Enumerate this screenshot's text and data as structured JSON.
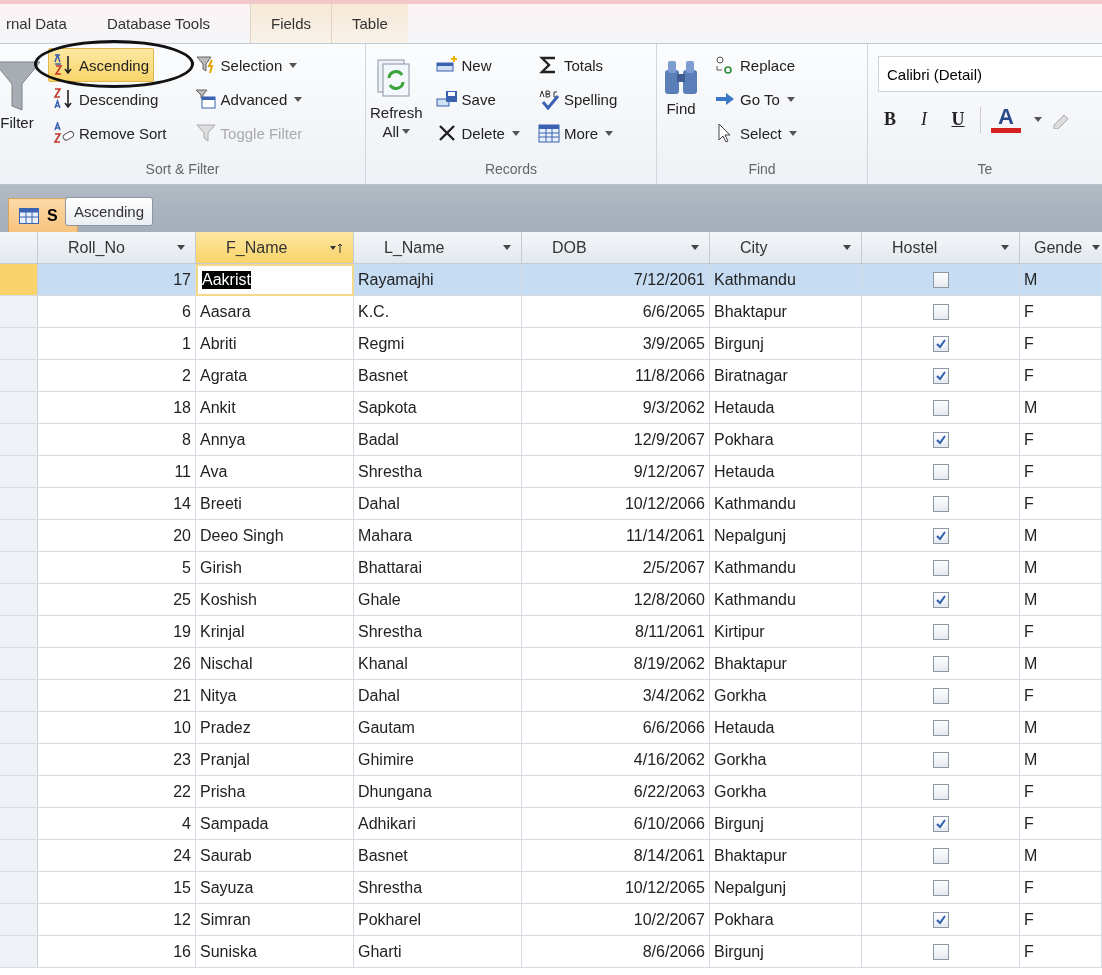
{
  "ribbon_tabs": [
    {
      "label": "rnal Data",
      "contextual": false
    },
    {
      "label": "Database Tools",
      "contextual": false
    },
    {
      "label": "Fields",
      "contextual": true
    },
    {
      "label": "Table",
      "contextual": true
    }
  ],
  "sort_filter": {
    "label": "Sort & Filter",
    "large_button": "Filter",
    "items": [
      {
        "label": "Ascending",
        "dropdown": false,
        "disabled": false,
        "highlighted": true,
        "circled": true
      },
      {
        "label": "Descending",
        "dropdown": false,
        "disabled": false,
        "highlighted": false,
        "circled": false
      },
      {
        "label": "Remove Sort",
        "dropdown": false,
        "disabled": false,
        "highlighted": false,
        "circled": false
      },
      {
        "label": "Selection",
        "dropdown": true,
        "disabled": false,
        "highlighted": false,
        "circled": false
      },
      {
        "label": "Advanced",
        "dropdown": true,
        "disabled": false,
        "highlighted": false,
        "circled": false
      },
      {
        "label": "Toggle Filter",
        "dropdown": false,
        "disabled": true,
        "highlighted": false,
        "circled": false
      }
    ]
  },
  "records": {
    "label": "Records",
    "large_button": "Refresh",
    "large_button_line2": "All",
    "items": [
      {
        "label": "New",
        "dropdown": false
      },
      {
        "label": "Save",
        "dropdown": false
      },
      {
        "label": "Delete",
        "dropdown": true
      },
      {
        "label": "Totals",
        "dropdown": false
      },
      {
        "label": "Spelling",
        "dropdown": false
      },
      {
        "label": "More",
        "dropdown": true
      }
    ]
  },
  "find": {
    "label": "Find",
    "large_button": "Find",
    "items": [
      {
        "label": "Replace",
        "dropdown": false
      },
      {
        "label": "Go To",
        "dropdown": true
      },
      {
        "label": "Select",
        "dropdown": true
      }
    ]
  },
  "text_formatting": {
    "label": "Te",
    "font_field": "Calibri (Detail)",
    "buttons": [
      "B",
      "I",
      "U"
    ],
    "font_color_button": "A"
  },
  "document_tab": {
    "label": "S"
  },
  "tooltip": {
    "text": "Ascending"
  },
  "table": {
    "columns": [
      {
        "label": "Roll_No",
        "sorted": false,
        "selected": false
      },
      {
        "label": "F_Name",
        "sorted": true,
        "selected": true
      },
      {
        "label": "L_Name",
        "sorted": false,
        "selected": false
      },
      {
        "label": "DOB",
        "sorted": false,
        "selected": false
      },
      {
        "label": "City",
        "sorted": false,
        "selected": false
      },
      {
        "label": "Hostel",
        "sorted": false,
        "selected": false
      },
      {
        "label": "Gende",
        "sorted": false,
        "selected": false
      }
    ],
    "rows": [
      {
        "roll_no": "17",
        "f_name": "Aakrist",
        "l_name": "Rayamajhi",
        "dob": "7/12/2061",
        "city": "Kathmandu",
        "hostel": false,
        "gender": "M",
        "selected": true,
        "editing": true
      },
      {
        "roll_no": "6",
        "f_name": "Aasara",
        "l_name": "K.C.",
        "dob": "6/6/2065",
        "city": "Bhaktapur",
        "hostel": false,
        "gender": "F",
        "selected": false,
        "editing": false
      },
      {
        "roll_no": "1",
        "f_name": "Abriti",
        "l_name": "Regmi",
        "dob": "3/9/2065",
        "city": "Birgunj",
        "hostel": true,
        "gender": "F",
        "selected": false,
        "editing": false
      },
      {
        "roll_no": "2",
        "f_name": "Agrata",
        "l_name": "Basnet",
        "dob": "11/8/2066",
        "city": "Biratnagar",
        "hostel": true,
        "gender": "F",
        "selected": false,
        "editing": false
      },
      {
        "roll_no": "18",
        "f_name": "Ankit",
        "l_name": "Sapkota",
        "dob": "9/3/2062",
        "city": "Hetauda",
        "hostel": false,
        "gender": "M",
        "selected": false,
        "editing": false
      },
      {
        "roll_no": "8",
        "f_name": "Annya",
        "l_name": "Badal",
        "dob": "12/9/2067",
        "city": "Pokhara",
        "hostel": true,
        "gender": "F",
        "selected": false,
        "editing": false
      },
      {
        "roll_no": "11",
        "f_name": "Ava",
        "l_name": "Shrestha",
        "dob": "9/12/2067",
        "city": "Hetauda",
        "hostel": false,
        "gender": "F",
        "selected": false,
        "editing": false
      },
      {
        "roll_no": "14",
        "f_name": "Breeti",
        "l_name": "Dahal",
        "dob": "10/12/2066",
        "city": "Kathmandu",
        "hostel": false,
        "gender": "F",
        "selected": false,
        "editing": false
      },
      {
        "roll_no": "20",
        "f_name": "Deeo Singh",
        "l_name": "Mahara",
        "dob": "11/14/2061",
        "city": "Nepalgunj",
        "hostel": true,
        "gender": "M",
        "selected": false,
        "editing": false
      },
      {
        "roll_no": "5",
        "f_name": "Girish",
        "l_name": "Bhattarai",
        "dob": "2/5/2067",
        "city": "Kathmandu",
        "hostel": false,
        "gender": "M",
        "selected": false,
        "editing": false
      },
      {
        "roll_no": "25",
        "f_name": "Koshish",
        "l_name": "Ghale",
        "dob": "12/8/2060",
        "city": "Kathmandu",
        "hostel": true,
        "gender": "M",
        "selected": false,
        "editing": false
      },
      {
        "roll_no": "19",
        "f_name": "Krinjal",
        "l_name": "Shrestha",
        "dob": "8/11/2061",
        "city": "Kirtipur",
        "hostel": false,
        "gender": "F",
        "selected": false,
        "editing": false
      },
      {
        "roll_no": "26",
        "f_name": "Nischal",
        "l_name": "Khanal",
        "dob": "8/19/2062",
        "city": "Bhaktapur",
        "hostel": false,
        "gender": "M",
        "selected": false,
        "editing": false
      },
      {
        "roll_no": "21",
        "f_name": "Nitya",
        "l_name": "Dahal",
        "dob": "3/4/2062",
        "city": "Gorkha",
        "hostel": false,
        "gender": "F",
        "selected": false,
        "editing": false
      },
      {
        "roll_no": "10",
        "f_name": "Pradez",
        "l_name": "Gautam",
        "dob": "6/6/2066",
        "city": "Hetauda",
        "hostel": false,
        "gender": "M",
        "selected": false,
        "editing": false
      },
      {
        "roll_no": "23",
        "f_name": "Pranjal",
        "l_name": "Ghimire",
        "dob": "4/16/2062",
        "city": "Gorkha",
        "hostel": false,
        "gender": "M",
        "selected": false,
        "editing": false
      },
      {
        "roll_no": "22",
        "f_name": "Prisha",
        "l_name": "Dhungana",
        "dob": "6/22/2063",
        "city": "Gorkha",
        "hostel": false,
        "gender": "F",
        "selected": false,
        "editing": false
      },
      {
        "roll_no": "4",
        "f_name": "Sampada",
        "l_name": "Adhikari",
        "dob": "6/10/2066",
        "city": "Birgunj",
        "hostel": true,
        "gender": "F",
        "selected": false,
        "editing": false
      },
      {
        "roll_no": "24",
        "f_name": "Saurab",
        "l_name": "Basnet",
        "dob": "8/14/2061",
        "city": "Bhaktapur",
        "hostel": false,
        "gender": "M",
        "selected": false,
        "editing": false
      },
      {
        "roll_no": "15",
        "f_name": "Sayuza",
        "l_name": "Shrestha",
        "dob": "10/12/2065",
        "city": "Nepalgunj",
        "hostel": false,
        "gender": "F",
        "selected": false,
        "editing": false
      },
      {
        "roll_no": "12",
        "f_name": "Simran",
        "l_name": "Pokharel",
        "dob": "10/2/2067",
        "city": "Pokhara",
        "hostel": true,
        "gender": "F",
        "selected": false,
        "editing": false
      },
      {
        "roll_no": "16",
        "f_name": "Suniska",
        "l_name": "Gharti",
        "dob": "8/6/2066",
        "city": "Birgunj",
        "hostel": false,
        "gender": "F",
        "selected": false,
        "editing": false
      }
    ]
  }
}
